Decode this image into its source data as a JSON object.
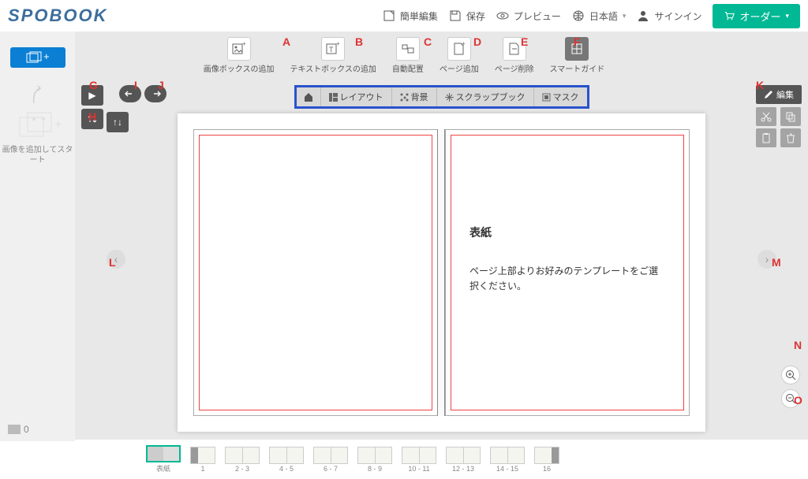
{
  "logo": "SPOBOOK",
  "header": {
    "easy_edit": "簡単編集",
    "save": "保存",
    "preview": "プレビュー",
    "language": "日本語",
    "signin": "サインイン",
    "order": "オーダー"
  },
  "toolbar": {
    "add_image_box": "画像ボックスの追加",
    "add_text_box": "テキストボックスの追加",
    "auto_layout": "自動配置",
    "add_page": "ページ追加",
    "delete_page": "ページ削除",
    "smart_guide": "スマートガイド"
  },
  "left": {
    "prompt": "画像を追加してスタート",
    "count": "0"
  },
  "tabs": {
    "layout": "レイアウト",
    "background": "背景",
    "scrapbook": "スクラップブック",
    "mask": "マスク"
  },
  "edit_panel": {
    "edit": "編集"
  },
  "cover": {
    "title": "表紙",
    "desc": "ページ上部よりお好みのテンプレートをご選択ください。"
  },
  "thumbs": [
    "表紙",
    "1",
    "2 - 3",
    "4 - 5",
    "6 - 7",
    "8 - 9",
    "10 - 11",
    "12 - 13",
    "14 - 15",
    "16"
  ],
  "annotations": {
    "A": "A",
    "B": "B",
    "C": "C",
    "D": "D",
    "E": "E",
    "F": "F",
    "G": "G",
    "H": "H",
    "I": "I",
    "J": "J",
    "K": "K",
    "L": "L",
    "M": "M",
    "N": "N",
    "O": "O"
  }
}
